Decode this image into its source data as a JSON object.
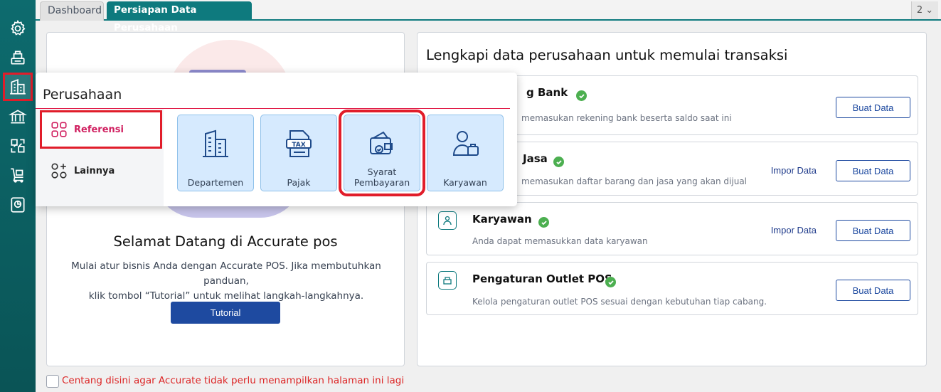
{
  "tabs": {
    "dashboard": "Dashboard",
    "persiapan": "Persiapan Data Perusahaan",
    "counter": "2 ⌄"
  },
  "sidebar": {
    "icons": [
      "settings-icon",
      "cashier-icon",
      "company-building-icon",
      "bank-building-icon",
      "inventory-icon",
      "cart-icon",
      "report-icon"
    ]
  },
  "left": {
    "title": "Selamat Datang di Accurate pos",
    "desc_line1": "Mulai atur bisnis Anda dengan Accurate POS. Jika membutuhkan panduan,",
    "desc_line2": "klik tombol “Tutorial” untuk melihat langkah-langkahnya.",
    "tutorial": "Tutorial"
  },
  "right": {
    "title": "Lengkapi data perusahaan untuk memulai transaksi",
    "rows": [
      {
        "title": "g Bank",
        "desc": "memasukan rekening bank beserta saldo saat ini",
        "buat": "Buat Data"
      },
      {
        "title": "Jasa",
        "desc": "memasukan daftar barang dan jasa yang akan dijual",
        "impor": "Impor Data",
        "buat": "Buat Data"
      },
      {
        "title": "Karyawan",
        "desc": "Anda dapat memasukkan data karyawan",
        "impor": "Impor Data",
        "buat": "Buat Data"
      },
      {
        "title": "Pengaturan Outlet POS",
        "desc": "Kelola pengaturan outlet POS sesuai dengan kebutuhan tiap cabang.",
        "buat": "Buat Data"
      }
    ]
  },
  "bottom": {
    "checkbox_label": "Centang disini agar Accurate tidak perlu menampilkan halaman ini lagi"
  },
  "popup": {
    "title": "Perusahaan",
    "nav": {
      "referensi": "Referensi",
      "lainnya": "Lainnya"
    },
    "tiles": {
      "departemen": "Departemen",
      "pajak": "Pajak",
      "syarat1": "Syarat",
      "syarat2": "Pembayaran",
      "karyawan": "Karyawan"
    }
  },
  "colors": {
    "sidebar": "#0d6b6e",
    "accent_red": "#e11d2a",
    "primary_blue": "#1e4aa0",
    "check_green": "#4caf50",
    "tile_bg": "#d6eafe"
  }
}
